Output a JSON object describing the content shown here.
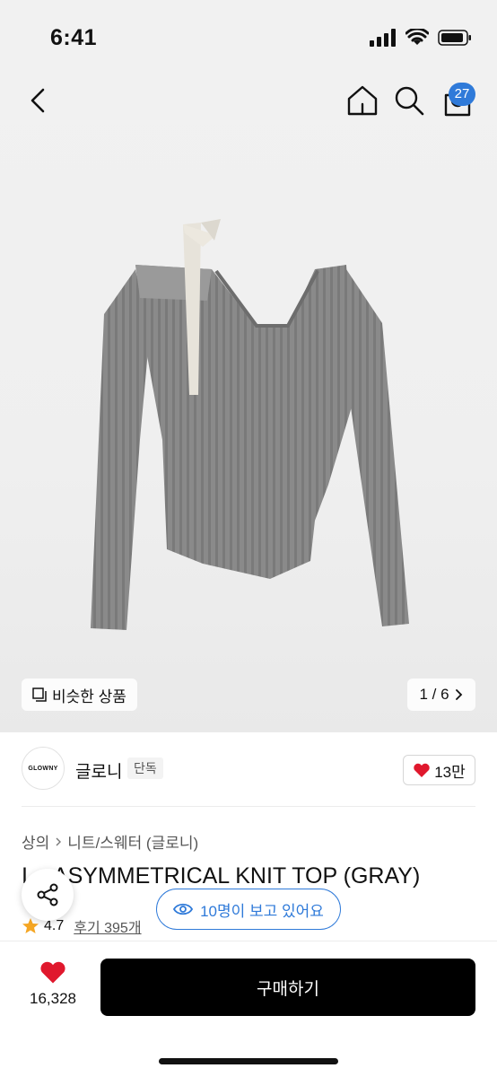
{
  "status_bar": {
    "time": "6:41"
  },
  "nav": {
    "cart_count": "27"
  },
  "gallery": {
    "similar_label": "비슷한 상품",
    "pager": "1 / 6"
  },
  "brand": {
    "logo_text": "GLOWNY",
    "name": "글로니",
    "tag": "단독",
    "likes": "13만"
  },
  "breadcrumb": {
    "category": "상의",
    "subcategory": "니트/스웨터 (글로니)"
  },
  "product": {
    "title": "IC... ASYMMETRICAL KNIT TOP (GRAY)",
    "title_visible": "ASYMMETRICAL KNIT TOP (GRAY)",
    "title_prefix": "I",
    "rating": "4.7",
    "reviews": "후기 395개"
  },
  "overlay": {
    "viewers": "10명이 보고 있어요"
  },
  "bottom": {
    "wish_count": "16,328",
    "buy_label": "구매하기"
  },
  "colors": {
    "accent": "#2f7ad9",
    "heart": "#e0182d",
    "star": "#f5a623",
    "buy": "#000000"
  }
}
